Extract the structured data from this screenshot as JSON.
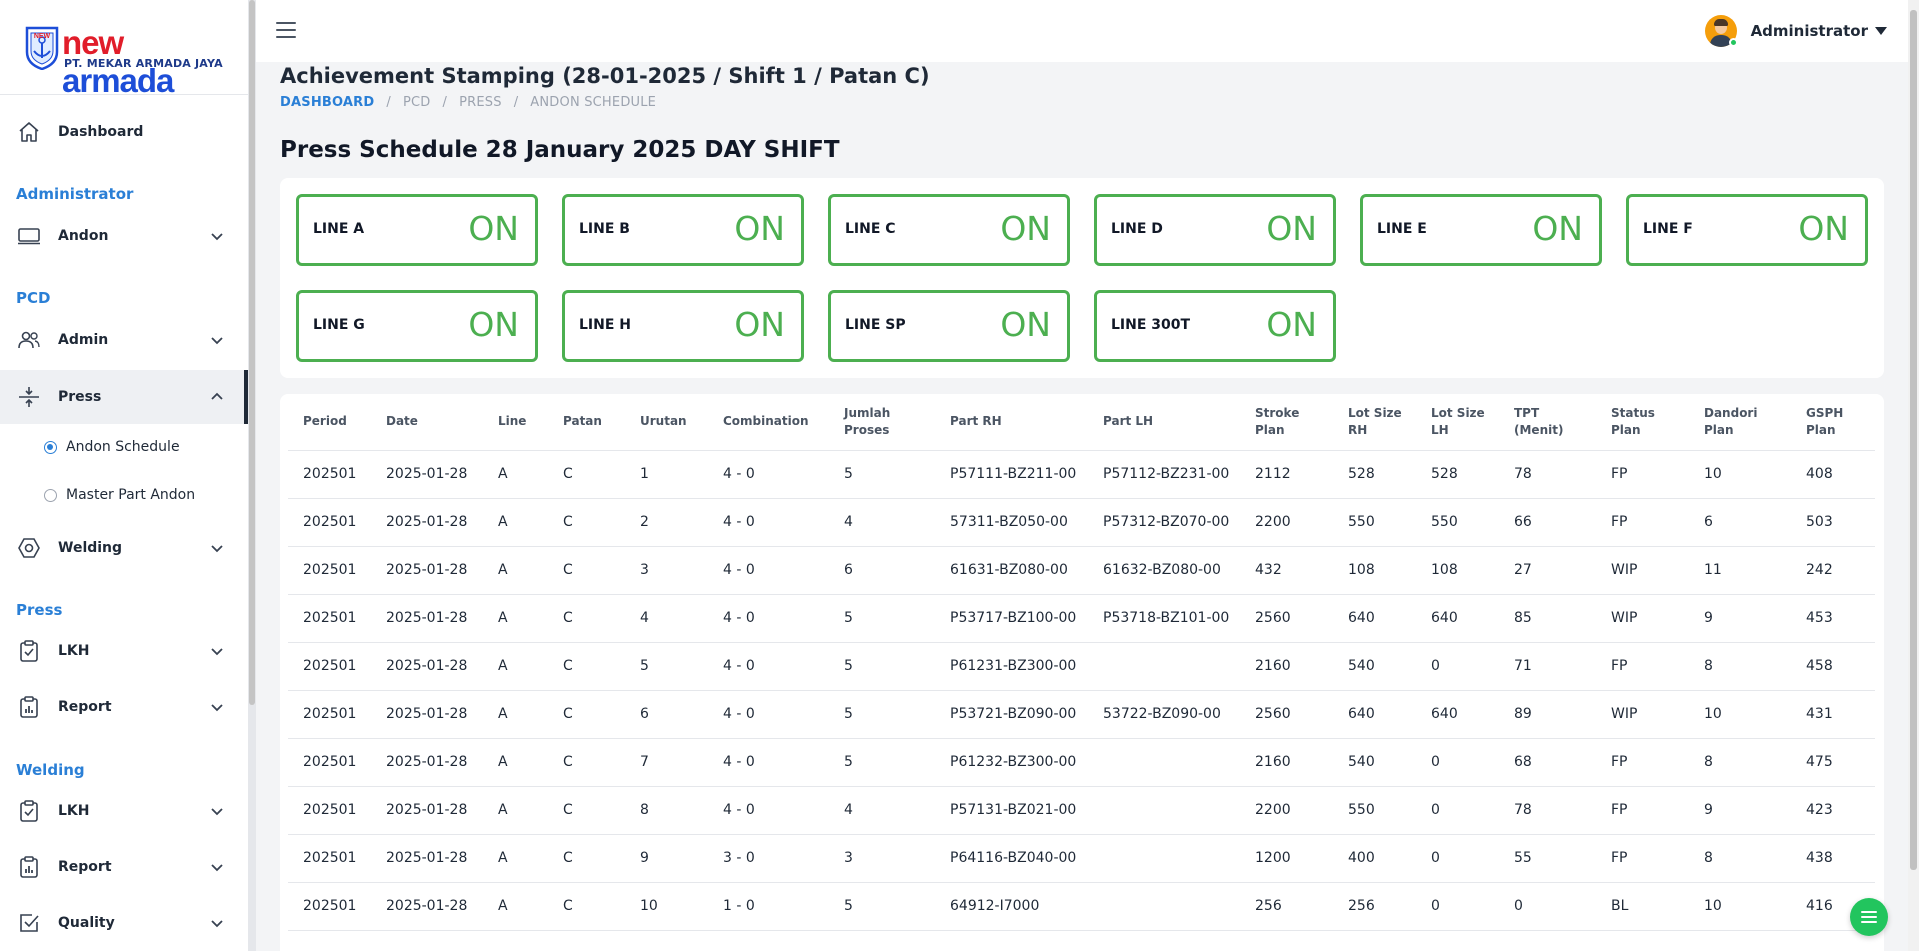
{
  "logo": {
    "brand_a": "new",
    "brand_b": " armada",
    "company": "PT. MEKAR ARMADA JAYA"
  },
  "sidebar": {
    "dashboard": "Dashboard",
    "sections": {
      "administrator": "Administrator",
      "pcd": "PCD",
      "press": "Press",
      "welding": "Welding"
    },
    "items": {
      "andon": "Andon",
      "admin": "Admin",
      "press": "Press",
      "andon_schedule": "Andon Schedule",
      "master_part_andon": "Master Part Andon",
      "welding": "Welding",
      "press_lkh": "LKH",
      "press_report": "Report",
      "welding_lkh": "LKH",
      "welding_report": "Report",
      "quality": "Quality"
    }
  },
  "header": {
    "user_name": "Administrator"
  },
  "page": {
    "title": "Achievement Stamping (28-01-2025 / Shift 1 / Patan C)",
    "breadcrumb": [
      "DASHBOARD",
      "/",
      "PCD",
      "/",
      "PRESS",
      "/",
      "ANDON SCHEDULE"
    ],
    "section_title": "Press Schedule 28 January 2025 DAY SHIFT"
  },
  "lines": [
    {
      "name": "LINE A",
      "status": "ON"
    },
    {
      "name": "LINE B",
      "status": "ON"
    },
    {
      "name": "LINE C",
      "status": "ON"
    },
    {
      "name": "LINE D",
      "status": "ON"
    },
    {
      "name": "LINE E",
      "status": "ON"
    },
    {
      "name": "LINE F",
      "status": "ON"
    },
    {
      "name": "LINE G",
      "status": "ON"
    },
    {
      "name": "LINE H",
      "status": "ON"
    },
    {
      "name": "LINE SP",
      "status": "ON"
    },
    {
      "name": "LINE 300T",
      "status": "ON"
    }
  ],
  "colors": {
    "accent": "#2a7fd6",
    "on_green": "#4caf50"
  },
  "table": {
    "headers": [
      "Period",
      "Date",
      "Line",
      "Patan",
      "Urutan",
      "Combination",
      "Jumlah\nProses",
      "Part RH",
      "Part LH",
      "Stroke\nPlan",
      "Lot Size\nRH",
      "Lot Size\nLH",
      "TPT\n(Menit)",
      "Status\nPlan",
      "Dandori\nPlan",
      "GSPH\nPlan"
    ],
    "rows": [
      [
        "202501",
        "2025-01-28",
        "A",
        "C",
        "1",
        "4 - 0",
        "5",
        "P57111-BZ211-00",
        "P57112-BZ231-00",
        "2112",
        "528",
        "528",
        "78",
        "FP",
        "10",
        "408"
      ],
      [
        "202501",
        "2025-01-28",
        "A",
        "C",
        "2",
        "4 - 0",
        "4",
        "57311-BZ050-00",
        "P57312-BZ070-00",
        "2200",
        "550",
        "550",
        "66",
        "FP",
        "6",
        "503"
      ],
      [
        "202501",
        "2025-01-28",
        "A",
        "C",
        "3",
        "4 - 0",
        "6",
        "61631-BZ080-00",
        "61632-BZ080-00",
        "432",
        "108",
        "108",
        "27",
        "WIP",
        "11",
        "242"
      ],
      [
        "202501",
        "2025-01-28",
        "A",
        "C",
        "4",
        "4 - 0",
        "5",
        "P53717-BZ100-00",
        "P53718-BZ101-00",
        "2560",
        "640",
        "640",
        "85",
        "WIP",
        "9",
        "453"
      ],
      [
        "202501",
        "2025-01-28",
        "A",
        "C",
        "5",
        "4 - 0",
        "5",
        "P61231-BZ300-00",
        "",
        "2160",
        "540",
        "0",
        "71",
        "FP",
        "8",
        "458"
      ],
      [
        "202501",
        "2025-01-28",
        "A",
        "C",
        "6",
        "4 - 0",
        "5",
        "P53721-BZ090-00",
        "53722-BZ090-00",
        "2560",
        "640",
        "640",
        "89",
        "WIP",
        "10",
        "431"
      ],
      [
        "202501",
        "2025-01-28",
        "A",
        "C",
        "7",
        "4 - 0",
        "5",
        "P61232-BZ300-00",
        "",
        "2160",
        "540",
        "0",
        "68",
        "FP",
        "8",
        "475"
      ],
      [
        "202501",
        "2025-01-28",
        "A",
        "C",
        "8",
        "4 - 0",
        "4",
        "P57131-BZ021-00",
        "",
        "2200",
        "550",
        "0",
        "78",
        "FP",
        "9",
        "423"
      ],
      [
        "202501",
        "2025-01-28",
        "A",
        "C",
        "9",
        "3 - 0",
        "3",
        "P64116-BZ040-00",
        "",
        "1200",
        "400",
        "0",
        "55",
        "FP",
        "8",
        "438"
      ],
      [
        "202501",
        "2025-01-28",
        "A",
        "C",
        "10",
        "1 - 0",
        "5",
        "64912-I7000",
        "",
        "256",
        "256",
        "0",
        "0",
        "BL",
        "10",
        "416"
      ]
    ]
  }
}
